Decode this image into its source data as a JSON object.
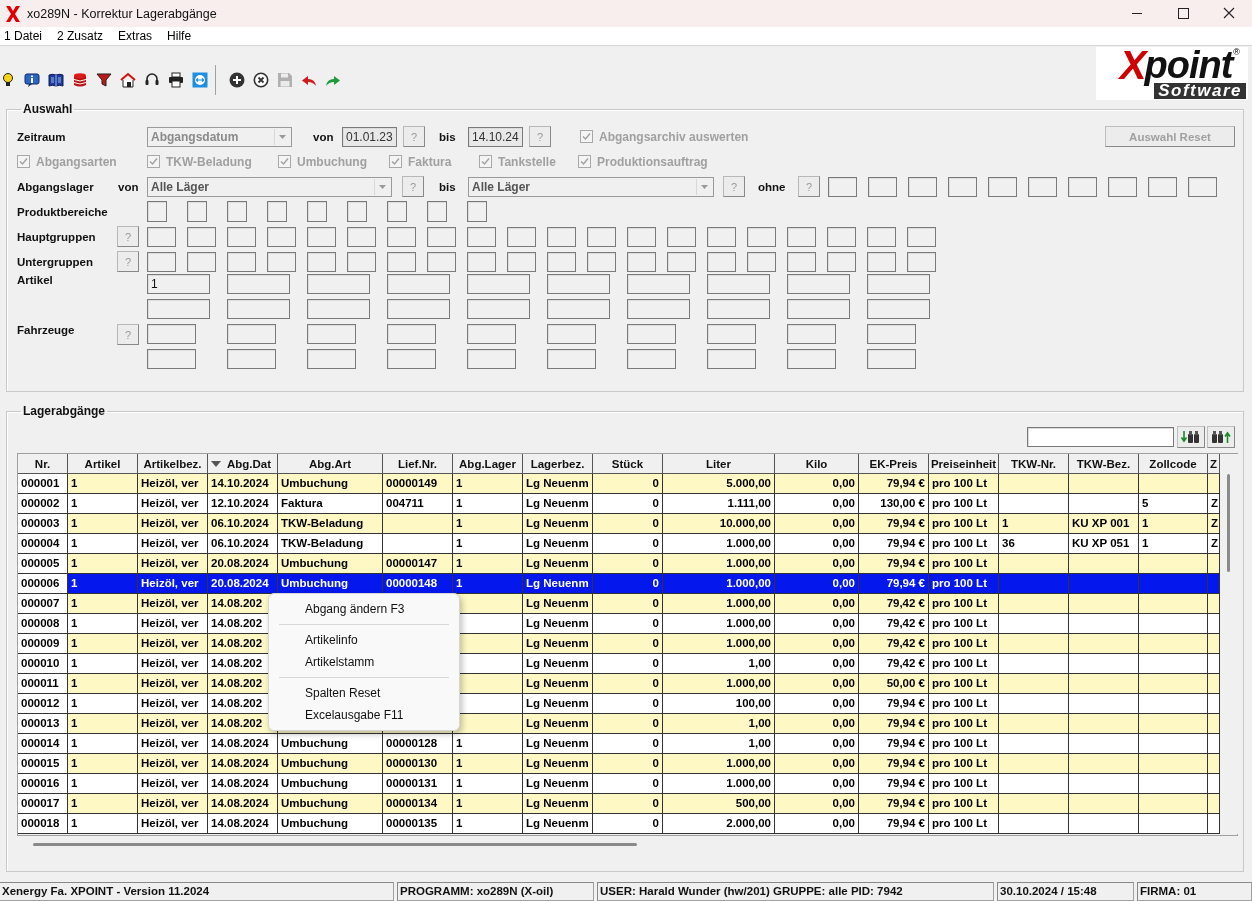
{
  "window": {
    "title": "xo289N - Korrektur Lagerabgänge"
  },
  "menu": [
    "1 Datei",
    "2 Zusatz",
    "Extras",
    "Hilfe"
  ],
  "toolbar": [
    {
      "kind": "bulb",
      "disabled": false
    },
    {
      "kind": "info",
      "disabled": false
    },
    {
      "kind": "book",
      "disabled": false
    },
    {
      "kind": "database",
      "disabled": false
    },
    {
      "kind": "funnel",
      "disabled": false
    },
    {
      "kind": "home",
      "disabled": false
    },
    {
      "kind": "headset",
      "disabled": false
    },
    {
      "kind": "printer",
      "disabled": false
    },
    {
      "kind": "remote",
      "disabled": false
    },
    {
      "kind": "separator"
    },
    {
      "kind": "add",
      "disabled": false
    },
    {
      "kind": "cancel",
      "disabled": false
    },
    {
      "kind": "save",
      "disabled": true
    },
    {
      "kind": "undo",
      "disabled": false
    },
    {
      "kind": "redo",
      "disabled": false
    }
  ],
  "logo": {
    "mark": "X",
    "name": "point",
    "registered": "®",
    "tagline": "Software"
  },
  "auswahl": {
    "title": "Auswahl",
    "zeitraum": {
      "label": "Zeitraum",
      "combo": {
        "value": "Abgangsdatum",
        "disabled": true
      },
      "von_label": "von",
      "von_value": "01.01.23",
      "von_help": "?",
      "bis_label": "bis",
      "bis_value": "14.10.24",
      "bis_help": "?",
      "archiv": {
        "label": "Abgangsarchiv auswerten",
        "checked": true,
        "disabled": true
      }
    },
    "reset_button": {
      "label": "Auswahl Reset",
      "disabled": true
    },
    "abgangsarten": [
      {
        "label": "Abgangsarten",
        "checked": true,
        "disabled": true
      },
      {
        "label": "TKW-Beladung",
        "checked": true,
        "disabled": true
      },
      {
        "label": "Umbuchung",
        "checked": true,
        "disabled": true
      },
      {
        "label": "Faktura",
        "checked": true,
        "disabled": true
      },
      {
        "label": "Tankstelle",
        "checked": true,
        "disabled": true
      },
      {
        "label": "Produktionsauftrag",
        "checked": true,
        "disabled": true
      }
    ],
    "abgangslager": {
      "label": "Abgangslager",
      "von_label": "von",
      "von_combo": {
        "value": "Alle Läger",
        "disabled": false
      },
      "von_help": "?",
      "bis_label": "bis",
      "bis_combo": {
        "value": "Alle Läger",
        "disabled": false
      },
      "bis_help": "?",
      "ohne_label": "ohne",
      "ohne_help": "?"
    },
    "produktbereiche": {
      "label": "Produktbereiche"
    },
    "hauptgruppen": {
      "label": "Hauptgruppen",
      "help": "?"
    },
    "untergruppen": {
      "label": "Untergruppen",
      "help": "?"
    },
    "artikel": {
      "label": "Artikel",
      "values": [
        "1"
      ]
    },
    "fahrzeuge": {
      "label": "Fahrzeuge",
      "help": "?"
    }
  },
  "lagerabgaenge": {
    "title": "Lagerabgänge",
    "columns": [
      {
        "label": "Nr.",
        "sorted": false
      },
      {
        "label": "Artikel",
        "sorted": false
      },
      {
        "label": "Artikelbez.",
        "sorted": false
      },
      {
        "label": "Abg.Dat",
        "sorted": true
      },
      {
        "label": "Abg.Art",
        "sorted": false
      },
      {
        "label": "Lief.Nr.",
        "sorted": false
      },
      {
        "label": "Abg.Lager",
        "sorted": false
      },
      {
        "label": "Lagerbez.",
        "sorted": false
      },
      {
        "label": "Stück",
        "sorted": false
      },
      {
        "label": "Liter",
        "sorted": false
      },
      {
        "label": "Kilo",
        "sorted": false
      },
      {
        "label": "EK-Preis",
        "sorted": false
      },
      {
        "label": "Preiseinheit",
        "sorted": false
      },
      {
        "label": "TKW-Nr.",
        "sorted": false
      },
      {
        "label": "TKW-Bez.",
        "sorted": false
      },
      {
        "label": "Zollcode",
        "sorted": false
      },
      {
        "label": "Z",
        "sorted": false
      }
    ],
    "rows": [
      {
        "selected": false,
        "cells": [
          "000001",
          "1",
          "Heizöl, ver",
          "14.10.2024",
          "Umbuchung",
          "00000149",
          "1",
          "Lg Neuenm",
          "0",
          "5.000,00",
          "0,00",
          "79,94 €",
          "pro 100 Lt",
          null,
          null,
          null,
          null
        ]
      },
      {
        "selected": false,
        "cells": [
          "000002",
          "1",
          "Heizöl, ver",
          "12.10.2024",
          "Faktura",
          "004711",
          "1",
          "Lg Neuenm",
          "0",
          "1.111,00",
          "0,00",
          "130,00 €",
          "pro 100 Lt",
          null,
          null,
          "5",
          "Z"
        ]
      },
      {
        "selected": false,
        "cells": [
          "000003",
          "1",
          "Heizöl, ver",
          "06.10.2024",
          "TKW-Beladung",
          null,
          "1",
          "Lg Neuenm",
          "0",
          "10.000,00",
          "0,00",
          "79,94 €",
          "pro 100 Lt",
          "1",
          "KU XP 001",
          "1",
          "Z"
        ]
      },
      {
        "selected": false,
        "cells": [
          "000004",
          "1",
          "Heizöl, ver",
          "06.10.2024",
          "TKW-Beladung",
          null,
          "1",
          "Lg Neuenm",
          "0",
          "1.000,00",
          "0,00",
          "79,94 €",
          "pro 100 Lt",
          "36",
          "KU XP 051",
          "1",
          "Z"
        ]
      },
      {
        "selected": false,
        "cells": [
          "000005",
          "1",
          "Heizöl, ver",
          "20.08.2024",
          "Umbuchung",
          "00000147",
          "1",
          "Lg Neuenm",
          "0",
          "1.000,00",
          "0,00",
          "79,94 €",
          "pro 100 Lt",
          null,
          null,
          null,
          null
        ]
      },
      {
        "selected": true,
        "cells": [
          "000006",
          "1",
          "Heizöl, ver",
          "20.08.2024",
          "Umbuchung",
          "00000148",
          "1",
          "Lg Neuenm",
          "0",
          "1.000,00",
          "0,00",
          "79,94 €",
          "pro 100 Lt",
          null,
          null,
          null,
          null
        ]
      },
      {
        "selected": false,
        "cells": [
          "000007",
          "1",
          "Heizöl, ver",
          "14.08.202",
          null,
          null,
          null,
          "Lg Neuenm",
          "0",
          "1.000,00",
          "0,00",
          "79,42 €",
          "pro 100 Lt",
          null,
          null,
          null,
          null
        ]
      },
      {
        "selected": false,
        "cells": [
          "000008",
          "1",
          "Heizöl, ver",
          "14.08.202",
          null,
          null,
          null,
          "Lg Neuenm",
          "0",
          "1.000,00",
          "0,00",
          "79,42 €",
          "pro 100 Lt",
          null,
          null,
          null,
          null
        ]
      },
      {
        "selected": false,
        "cells": [
          "000009",
          "1",
          "Heizöl, ver",
          "14.08.202",
          null,
          null,
          null,
          "Lg Neuenm",
          "0",
          "1.000,00",
          "0,00",
          "79,42 €",
          "pro 100 Lt",
          null,
          null,
          null,
          null
        ]
      },
      {
        "selected": false,
        "cells": [
          "000010",
          "1",
          "Heizöl, ver",
          "14.08.202",
          null,
          null,
          null,
          "Lg Neuenm",
          "0",
          "1,00",
          "0,00",
          "79,42 €",
          "pro 100 Lt",
          null,
          null,
          null,
          null
        ]
      },
      {
        "selected": false,
        "cells": [
          "000011",
          "1",
          "Heizöl, ver",
          "14.08.202",
          null,
          null,
          null,
          "Lg Neuenm",
          "0",
          "1.000,00",
          "0,00",
          "50,00 €",
          "pro 100 Lt",
          null,
          null,
          null,
          null
        ]
      },
      {
        "selected": false,
        "cells": [
          "000012",
          "1",
          "Heizöl, ver",
          "14.08.202",
          null,
          null,
          null,
          "Lg Neuenm",
          "0",
          "100,00",
          "0,00",
          "79,94 €",
          "pro 100 Lt",
          null,
          null,
          null,
          null
        ]
      },
      {
        "selected": false,
        "cells": [
          "000013",
          "1",
          "Heizöl, ver",
          "14.08.202",
          null,
          null,
          null,
          "Lg Neuenm",
          "0",
          "1,00",
          "0,00",
          "79,94 €",
          "pro 100 Lt",
          null,
          null,
          null,
          null
        ]
      },
      {
        "selected": false,
        "cells": [
          "000014",
          "1",
          "Heizöl, ver",
          "14.08.2024",
          "Umbuchung",
          "00000128",
          "1",
          "Lg Neuenm",
          "0",
          "1,00",
          "0,00",
          "79,94 €",
          "pro 100 Lt",
          null,
          null,
          null,
          null
        ]
      },
      {
        "selected": false,
        "cells": [
          "000015",
          "1",
          "Heizöl, ver",
          "14.08.2024",
          "Umbuchung",
          "00000130",
          "1",
          "Lg Neuenm",
          "0",
          "1.000,00",
          "0,00",
          "79,94 €",
          "pro 100 Lt",
          null,
          null,
          null,
          null
        ]
      },
      {
        "selected": false,
        "cells": [
          "000016",
          "1",
          "Heizöl, ver",
          "14.08.2024",
          "Umbuchung",
          "00000131",
          "1",
          "Lg Neuenm",
          "0",
          "1.000,00",
          "0,00",
          "79,94 €",
          "pro 100 Lt",
          null,
          null,
          null,
          null
        ]
      },
      {
        "selected": false,
        "cells": [
          "000017",
          "1",
          "Heizöl, ver",
          "14.08.2024",
          "Umbuchung",
          "00000134",
          "1",
          "Lg Neuenm",
          "0",
          "500,00",
          "0,00",
          "79,94 €",
          "pro 100 Lt",
          null,
          null,
          null,
          null
        ]
      },
      {
        "selected": false,
        "cells": [
          "000018",
          "1",
          "Heizöl, ver",
          "14.08.2024",
          "Umbuchung",
          "00000135",
          "1",
          "Lg Neuenm",
          "0",
          "2.000,00",
          "0,00",
          "79,94 €",
          "pro 100 Lt",
          null,
          null,
          null,
          null
        ]
      }
    ],
    "context_menu": [
      {
        "kind": "item",
        "label": "Abgang ändern F3"
      },
      {
        "kind": "separator"
      },
      {
        "kind": "item",
        "label": "Artikelinfo"
      },
      {
        "kind": "item",
        "label": "Artikelstamm"
      },
      {
        "kind": "separator"
      },
      {
        "kind": "item",
        "label": "Spalten Reset"
      },
      {
        "kind": "item",
        "label": "Excelausgabe F11"
      }
    ]
  },
  "status_bar": [
    "Xenergy Fa. XPOINT - Version 11.2024",
    "PROGRAMM: xo289N (X-oil)",
    "USER: Harald Wunder (hw/201)  GRUPPE: alle  PID: 7942",
    "30.10.2024 / 15:48",
    "FIRMA: 01"
  ]
}
